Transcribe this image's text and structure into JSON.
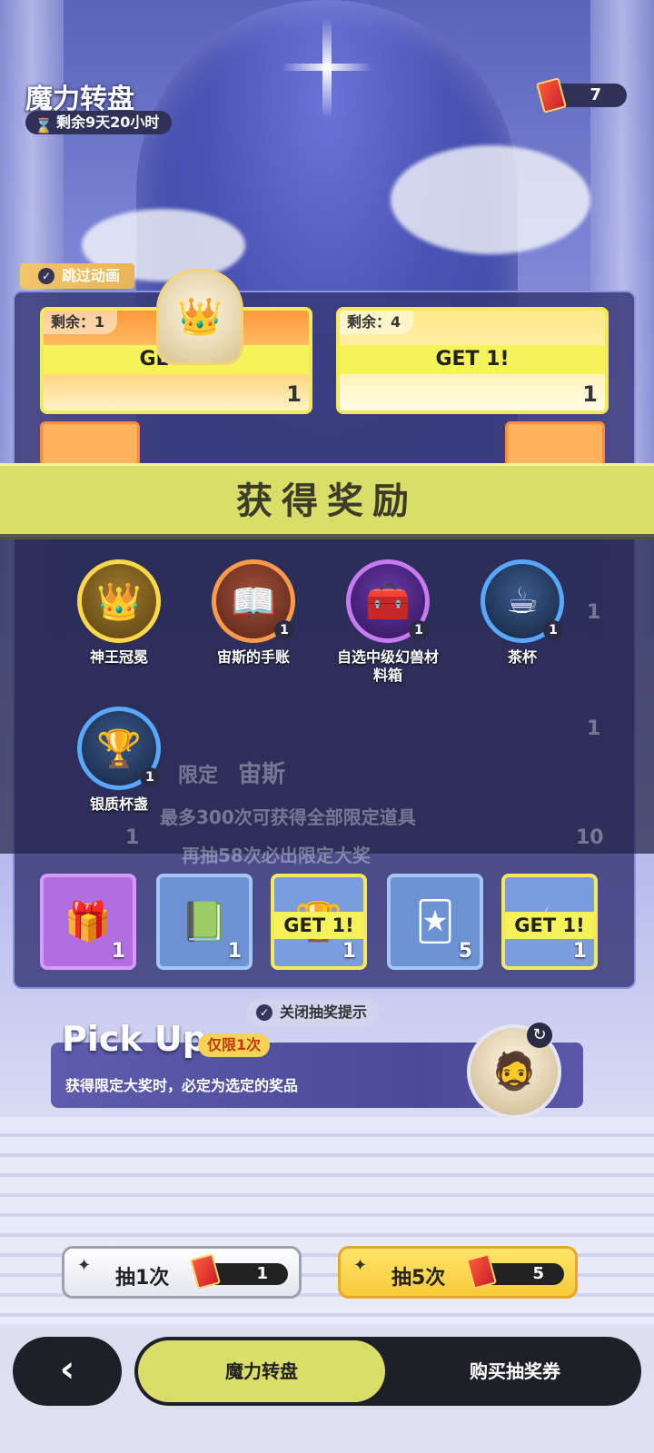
{
  "header": {
    "title": "魔力转盘",
    "timer_text": "剩余9天20小时",
    "ticket_count": "7"
  },
  "skip_animation": {
    "label": "跳过动画"
  },
  "prize_board": {
    "featured": [
      {
        "remaining_label": "剩余：1",
        "get_label": "GET 1!",
        "count": "1"
      },
      {
        "remaining_label": "剩余：4",
        "get_label": "GET 1!",
        "count": "1"
      }
    ],
    "background_text": {
      "limited": "限定",
      "name": "宙斯",
      "notice": "最多300次可获得全部限定道具",
      "guarantee": "再抽58次必出限定大奖"
    },
    "background_counts": [
      "1",
      "1",
      "1",
      "1",
      "1",
      "10"
    ],
    "bottom_row": [
      {
        "icon": "gift-box-icon",
        "count": "1",
        "get_label": ""
      },
      {
        "icon": "book-icon",
        "count": "1",
        "get_label": ""
      },
      {
        "icon": "goblet-icon",
        "count": "1",
        "get_label": "GET 1!"
      },
      {
        "icon": "card-icon",
        "count": "5",
        "get_label": ""
      },
      {
        "icon": "teacup-icon",
        "count": "1",
        "get_label": "GET 1!"
      }
    ]
  },
  "reward_popup": {
    "title": "获得奖励",
    "items": [
      {
        "name": "神王冠冕",
        "count": "",
        "icon": "crown-icon"
      },
      {
        "name": "宙斯的手账",
        "count": "1",
        "icon": "journal-icon"
      },
      {
        "name": "自选中级幻兽材料箱",
        "count": "1",
        "icon": "chest-icon"
      },
      {
        "name": "茶杯",
        "count": "1",
        "icon": "teacup-icon"
      },
      {
        "name": "银质杯盏",
        "count": "1",
        "icon": "goblet-icon"
      }
    ]
  },
  "pickup": {
    "close_hint_label": "关闭抽奖提示",
    "title": "Pick Up",
    "tag": "仅限1次",
    "description": "获得限定大奖时，必定为选定的奖品"
  },
  "draw_buttons": {
    "single": {
      "label": "抽1次",
      "cost": "1"
    },
    "multi": {
      "label": "抽5次",
      "cost": "5"
    }
  },
  "bottom_nav": {
    "back_icon": "‹",
    "tab_active": "魔力转盘",
    "tab_inactive": "购买抽奖券"
  },
  "colors": {
    "banner": "#d9de6a",
    "get_tag": "#f6f25a",
    "nav_active": "#d9de6a"
  }
}
